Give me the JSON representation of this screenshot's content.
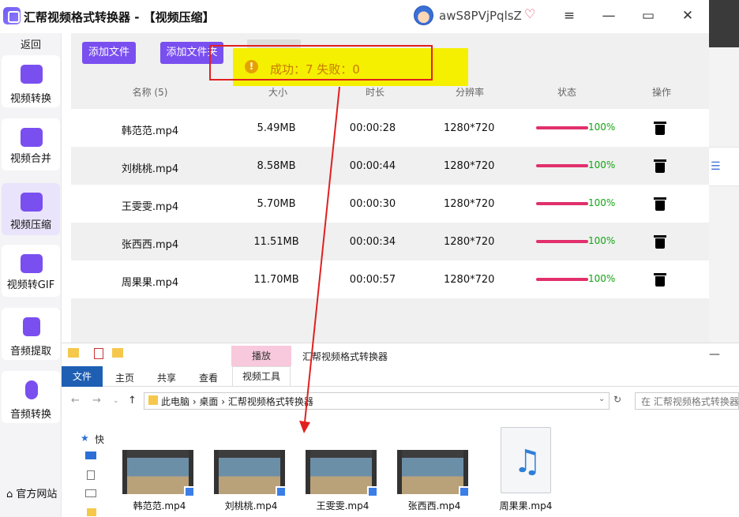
{
  "app": {
    "title": "汇帮视频格式转换器  - 【视频压缩】",
    "username": "awS8PVjPqlsZ",
    "minimize_icon": "menu-icon",
    "colors": {
      "accent": "#7a4ff0",
      "progress": "#e1306c",
      "success_text": "#12a512",
      "toast_bg": "#f5f000",
      "highlight": "#e02020"
    }
  },
  "sidebar": {
    "back_label": "返回",
    "items": [
      {
        "label": "视频转换",
        "icon": "video-convert-icon"
      },
      {
        "label": "视频合并",
        "icon": "video-merge-icon"
      },
      {
        "label": "视频压缩",
        "icon": "video-compress-icon",
        "active": true
      },
      {
        "label": "视频转GIF",
        "icon": "gif-icon"
      },
      {
        "label": "音频提取",
        "icon": "music-icon"
      },
      {
        "label": "音频转换",
        "icon": "microphone-icon"
      }
    ],
    "home_label": "官方网站"
  },
  "toolbar": {
    "add_file": "添加文件",
    "add_folder": "添加文件夹"
  },
  "toast": {
    "text": "成功：7    失败：0"
  },
  "table": {
    "headers": [
      "名称 (5)",
      "大小",
      "时长",
      "分辨率",
      "状态",
      "操作"
    ],
    "rows": [
      {
        "name": "韩范范.mp4",
        "size": "5.49MB",
        "duration": "00:00:28",
        "resolution": "1280*720",
        "progress": "100%"
      },
      {
        "name": "刘桃桃.mp4",
        "size": "8.58MB",
        "duration": "00:00:44",
        "resolution": "1280*720",
        "progress": "100%"
      },
      {
        "name": "王雯雯.mp4",
        "size": "5.70MB",
        "duration": "00:00:30",
        "resolution": "1280*720",
        "progress": "100%"
      },
      {
        "name": "张西西.mp4",
        "size": "11.51MB",
        "duration": "00:00:34",
        "resolution": "1280*720",
        "progress": "100%"
      },
      {
        "name": "周果果.mp4",
        "size": "11.70MB",
        "duration": "00:00:57",
        "resolution": "1280*720",
        "progress": "100%"
      }
    ]
  },
  "explorer": {
    "window_title": "汇帮视频格式转换器",
    "play_tab": "播放",
    "tabs": [
      "文件",
      "主页",
      "共享",
      "查看",
      "视频工具"
    ],
    "address": "此电脑  ›  桌面  ›  汇帮视频格式转换器",
    "search_placeholder": "在 汇帮视频格式转换器",
    "quick_access": "快",
    "files": [
      "韩范范.mp4",
      "刘桃桃.mp4",
      "王雯雯.mp4",
      "张西西.mp4",
      "周果果.mp4"
    ]
  }
}
